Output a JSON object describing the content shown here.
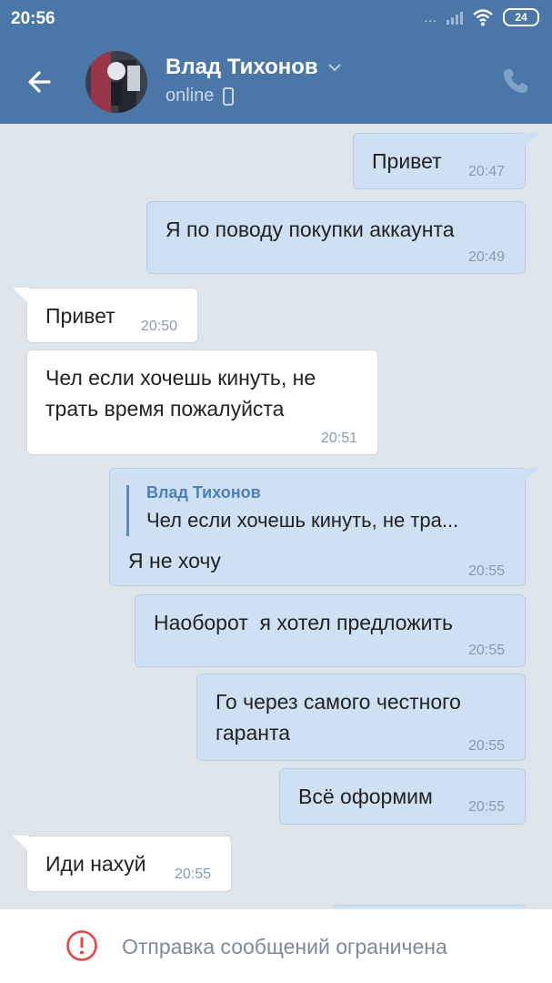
{
  "status_bar": {
    "time": "20:56",
    "dots": "...",
    "battery": "24"
  },
  "header": {
    "contact_name": "Влад Тихонов",
    "status": "online",
    "accent_color": "#4a76a8"
  },
  "messages": [
    {
      "direction": "out",
      "text": "Привет",
      "time": "20:47"
    },
    {
      "direction": "out",
      "text": "Я по поводу покупки аккаунта",
      "time": "20:49"
    },
    {
      "direction": "in",
      "text": "Привет",
      "time": "20:50"
    },
    {
      "direction": "in",
      "text": "Чел если хочешь кинуть, не\nтрать время пожалуйста",
      "time": "20:51"
    },
    {
      "direction": "out",
      "text": "Я не хочу",
      "time": "20:55",
      "reply": {
        "author": "Влад Тихонов",
        "text": "Чел если хочешь кинуть, не тра..."
      }
    },
    {
      "direction": "out",
      "text": "Наоборот  я хотел предложить",
      "time": "20:55"
    },
    {
      "direction": "out",
      "text": "Го через самого честного\nгаранта",
      "time": "20:55"
    },
    {
      "direction": "out",
      "text": "Всё оформим",
      "time": "20:55"
    },
    {
      "direction": "in",
      "text": "Иди нахуй",
      "time": "20:55"
    }
  ],
  "bottom_bar": {
    "restriction_text": "Отправка сообщений ограничена",
    "icon": "alert-circle-icon",
    "icon_color": "#e64646"
  }
}
